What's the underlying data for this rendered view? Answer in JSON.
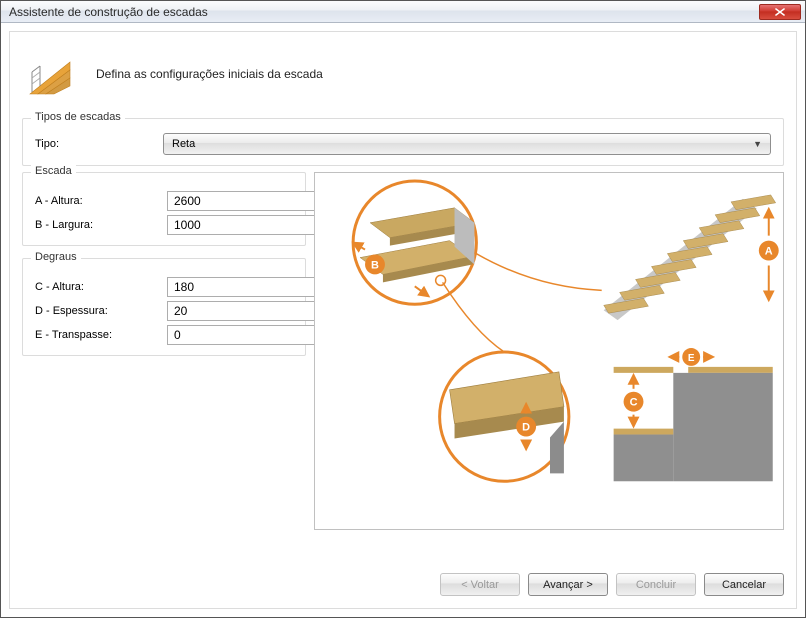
{
  "window": {
    "title": "Assistente de construção de escadas"
  },
  "header": {
    "text": "Defina as configurações iniciais da escada"
  },
  "groups": {
    "types": {
      "title": "Tipos de escadas",
      "type_label": "Tipo:",
      "type_value": "Reta"
    },
    "escada": {
      "title": "Escada",
      "altura_label": "A - Altura:",
      "altura_value": "2600",
      "largura_label": "B - Largura:",
      "largura_value": "1000"
    },
    "degraus": {
      "title": "Degraus",
      "altura_label": "C - Altura:",
      "altura_value": "180",
      "espessura_label": "D - Espessura:",
      "espessura_value": "20",
      "transpasse_label": "E - Transpasse:",
      "transpasse_value": "0"
    }
  },
  "diagram_markers": {
    "A": "A",
    "B": "B",
    "C": "C",
    "D": "D",
    "E": "E"
  },
  "buttons": {
    "back": "< Voltar",
    "next": "Avançar >",
    "finish": "Concluir",
    "cancel": "Cancelar"
  }
}
